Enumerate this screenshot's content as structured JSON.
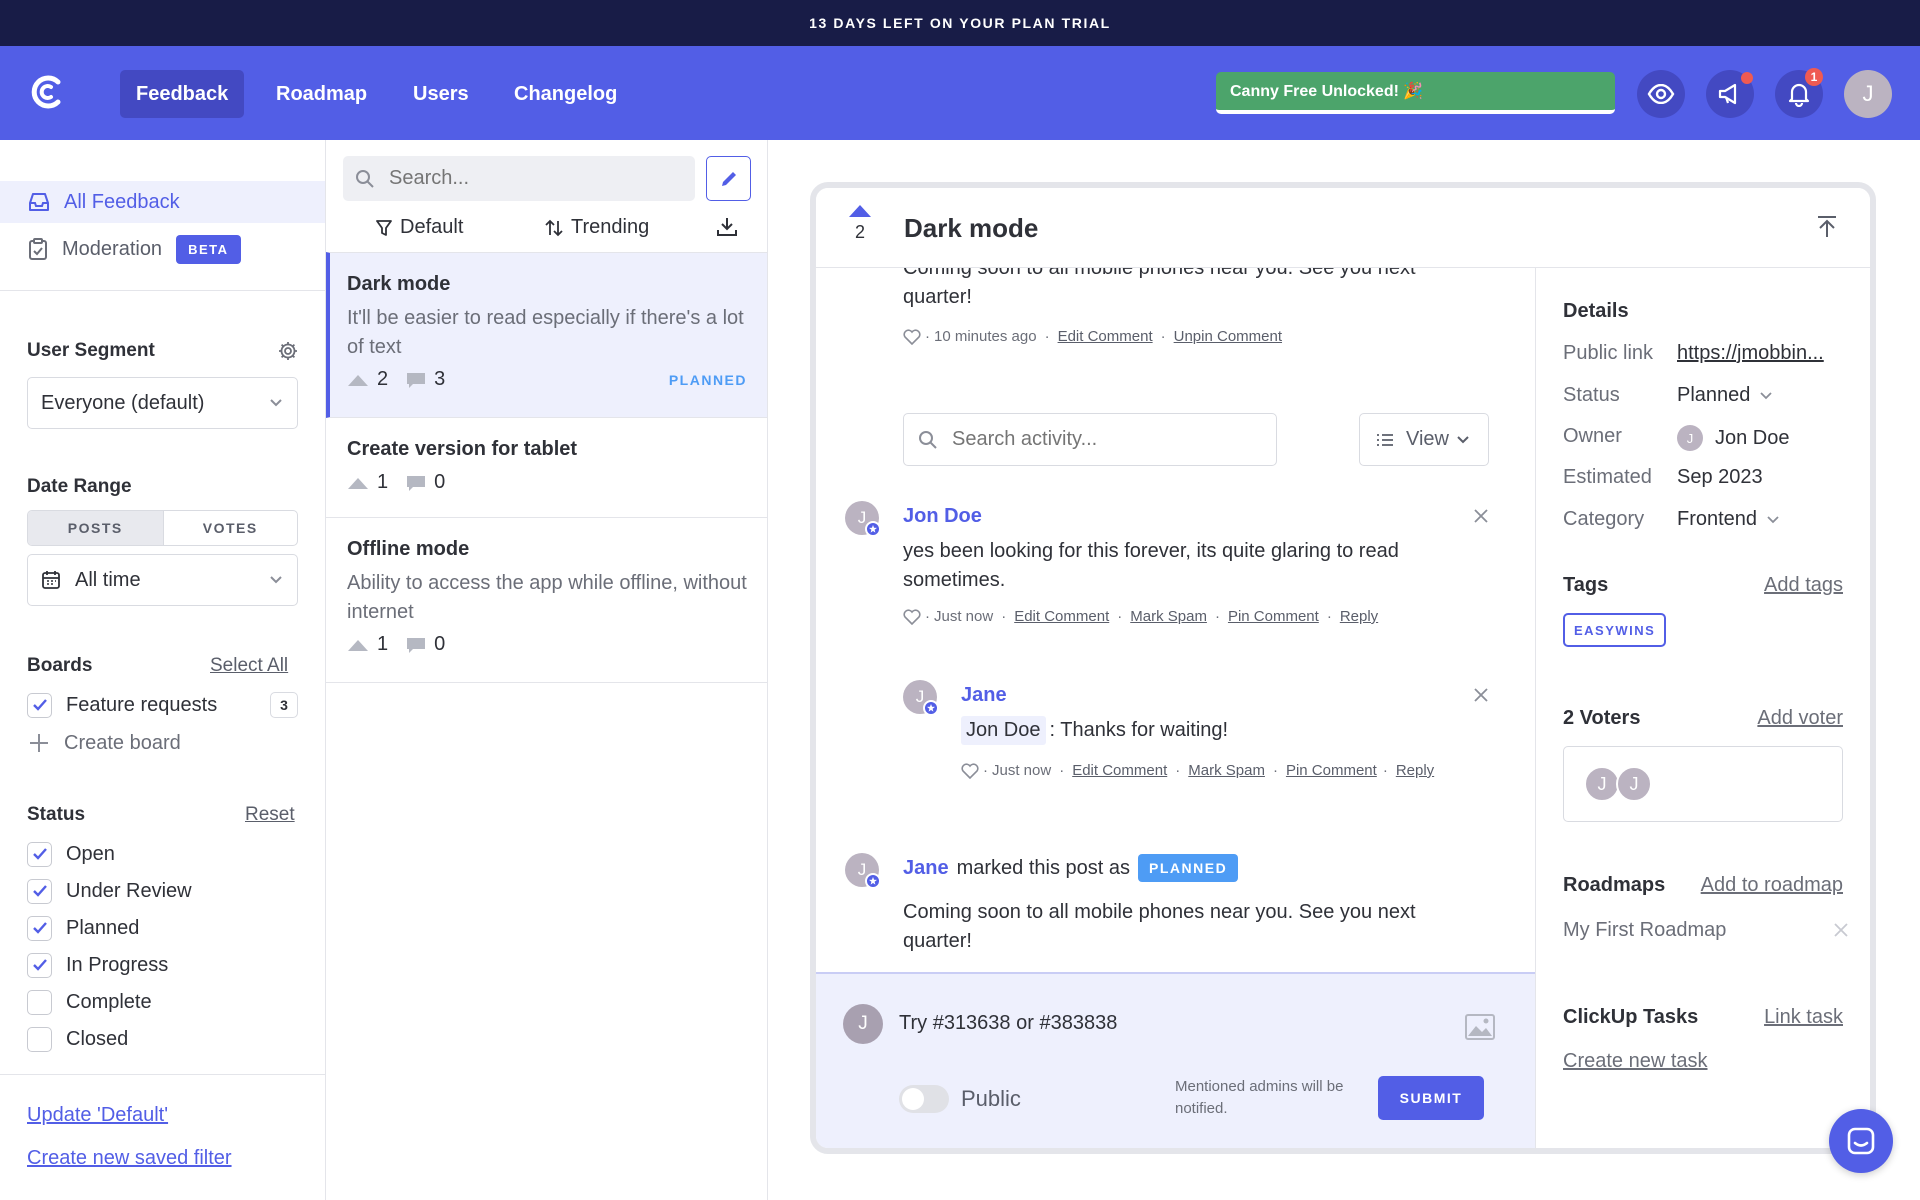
{
  "trial_banner": "13 DAYS LEFT ON YOUR PLAN TRIAL",
  "header": {
    "nav": [
      "Feedback",
      "Roadmap",
      "Users",
      "Changelog"
    ],
    "unlock_label": "Canny Free Unlocked! 🎉",
    "notification_count": "1",
    "avatar_letter": "J"
  },
  "sidebar": {
    "all_feedback": "All Feedback",
    "moderation": "Moderation",
    "beta": "BETA",
    "user_segment_title": "User Segment",
    "user_segment_value": "Everyone (default)",
    "date_range_title": "Date Range",
    "date_tabs": [
      "POSTS",
      "VOTES"
    ],
    "date_value": "All time",
    "boards_title": "Boards",
    "select_all": "Select All",
    "boards": [
      {
        "label": "Feature requests",
        "count": "3",
        "checked": true
      }
    ],
    "create_board": "Create board",
    "status_title": "Status",
    "reset": "Reset",
    "statuses": [
      {
        "label": "Open",
        "checked": true
      },
      {
        "label": "Under Review",
        "checked": true
      },
      {
        "label": "Planned",
        "checked": true
      },
      {
        "label": "In Progress",
        "checked": true
      },
      {
        "label": "Complete",
        "checked": false
      },
      {
        "label": "Closed",
        "checked": false
      }
    ],
    "update_filter": "Update 'Default'",
    "create_filter": "Create new saved filter"
  },
  "posts_list": {
    "search_placeholder": "Search...",
    "filter_label": "Default",
    "sort_label": "Trending",
    "posts": [
      {
        "title": "Dark mode",
        "desc": "It'll be easier to read especially if there's a lot of text",
        "votes": "2",
        "comments": "3",
        "status": "PLANNED"
      },
      {
        "title": "Create version for tablet",
        "desc": "",
        "votes": "1",
        "comments": "0",
        "status": ""
      },
      {
        "title": "Offline mode",
        "desc": "Ability to access the app while offline, without internet",
        "votes": "1",
        "comments": "0",
        "status": ""
      }
    ]
  },
  "post": {
    "title": "Dark mode",
    "votes": "2",
    "activity": {
      "top_text": "Coming soon to all mobile phones near you. See you next quarter!",
      "top_meta": {
        "time": "10 minutes ago",
        "edit": "Edit Comment",
        "unpin": "Unpin Comment"
      },
      "search_placeholder": "Search activity...",
      "view_label": "View",
      "comments": [
        {
          "avatar": "J",
          "author": "Jon Doe",
          "text": "yes been looking for this forever, its quite glaring to read sometimes.",
          "time": "Just now",
          "actions": [
            "Edit Comment",
            "Mark Spam",
            "Pin Comment",
            "Reply"
          ]
        },
        {
          "avatar": "J",
          "author": "Jane",
          "mention": "Jon Doe",
          "text": ": Thanks for waiting!",
          "time": "Just now",
          "actions": [
            "Edit Comment",
            "Mark Spam",
            "Pin Comment",
            "Reply"
          ]
        }
      ],
      "status_change": {
        "avatar": "J",
        "author": "Jane",
        "text": "marked this post as",
        "badge": "PLANNED",
        "note": "Coming soon to all mobile phones near you. See you next quarter!"
      }
    },
    "composer": {
      "avatar": "J",
      "text": "Try #313638 or #383838",
      "public_label": "Public",
      "notice": "Mentioned admins will be notified.",
      "submit": "SUBMIT"
    },
    "details": {
      "title": "Details",
      "rows": [
        {
          "label": "Public link",
          "value": "https://jmobbin..."
        },
        {
          "label": "Status",
          "value": "Planned"
        },
        {
          "label": "Owner",
          "value": "Jon Doe"
        },
        {
          "label": "Estimated",
          "value": "Sep 2023"
        },
        {
          "label": "Category",
          "value": "Frontend"
        }
      ],
      "tags_title": "Tags",
      "add_tags": "Add tags",
      "tag": "EASYWINS",
      "voters_title": "2 Voters",
      "add_voter": "Add voter",
      "voter_avatars": [
        "J",
        "J"
      ],
      "roadmaps_title": "Roadmaps",
      "add_roadmap": "Add to roadmap",
      "roadmap_item": "My First Roadmap",
      "clickup_title": "ClickUp Tasks",
      "link_task": "Link task",
      "create_task": "Create new task"
    }
  },
  "colors": {
    "brand": "#525ee6",
    "trial_bg": "#181c47",
    "success": "#4ca46b",
    "planned": "#4e9cf5"
  }
}
